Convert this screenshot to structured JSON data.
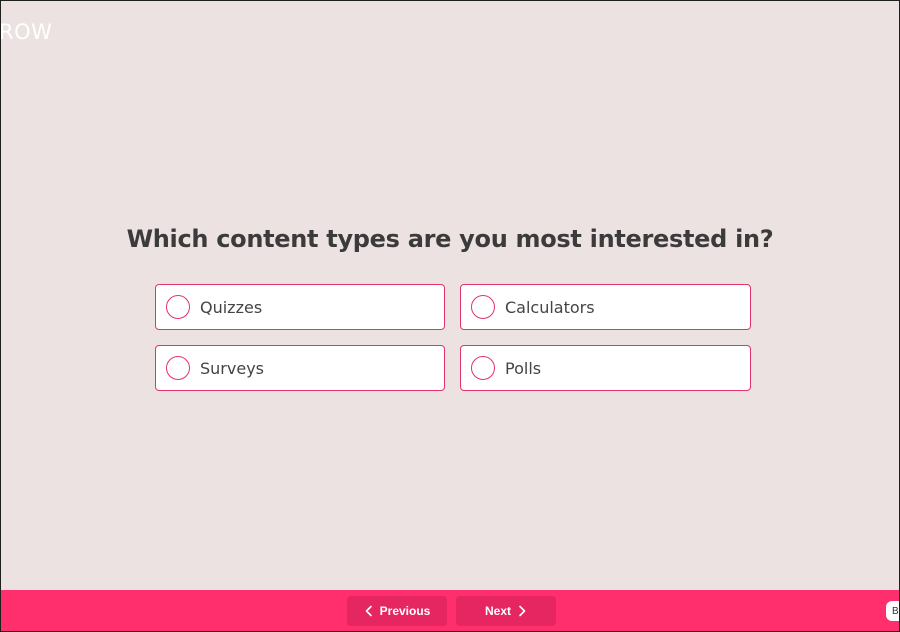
{
  "brand": {
    "text": "ROW"
  },
  "quiz": {
    "question": "Which content types are you most interested in?",
    "options": [
      {
        "label": "Quizzes",
        "selected": false
      },
      {
        "label": "Calculators",
        "selected": false
      },
      {
        "label": "Surveys",
        "selected": false
      },
      {
        "label": "Polls",
        "selected": false
      }
    ]
  },
  "footer": {
    "previous_label": "Previous",
    "next_label": "Next",
    "badge_text": "B",
    "background_color": "#ff2e6d",
    "button_color": "#e62661"
  },
  "theme": {
    "background": "#ece2e2",
    "accent": "#e2336d",
    "text": "#3b3b3b"
  },
  "icons": {
    "previous": "chevron-left-icon",
    "next": "chevron-right-icon",
    "option": "radio-circle-icon"
  }
}
